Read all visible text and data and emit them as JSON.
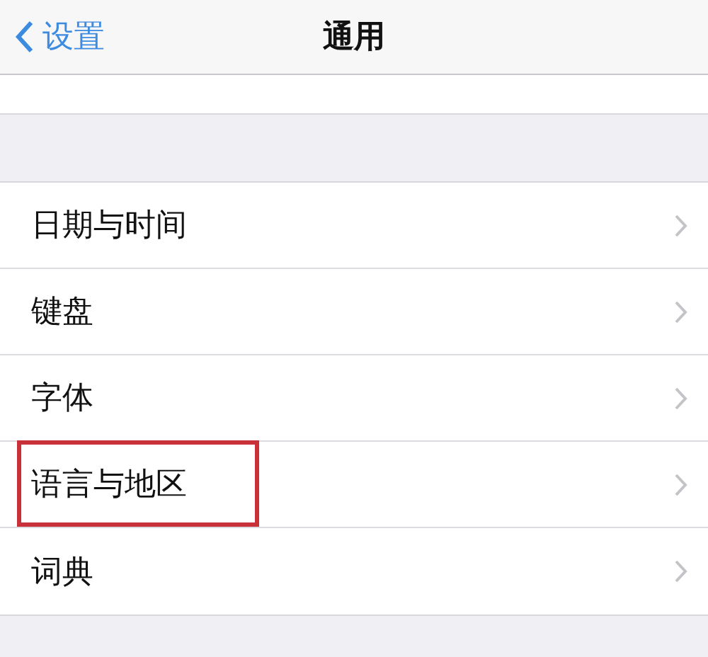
{
  "nav_bar": {
    "back_label": "设置",
    "title": "通用"
  },
  "rows": [
    {
      "label": "日期与时间",
      "highlighted": false
    },
    {
      "label": "键盘",
      "highlighted": false
    },
    {
      "label": "字体",
      "highlighted": false
    },
    {
      "label": "语言与地区",
      "highlighted": true
    },
    {
      "label": "词典",
      "highlighted": false
    }
  ]
}
